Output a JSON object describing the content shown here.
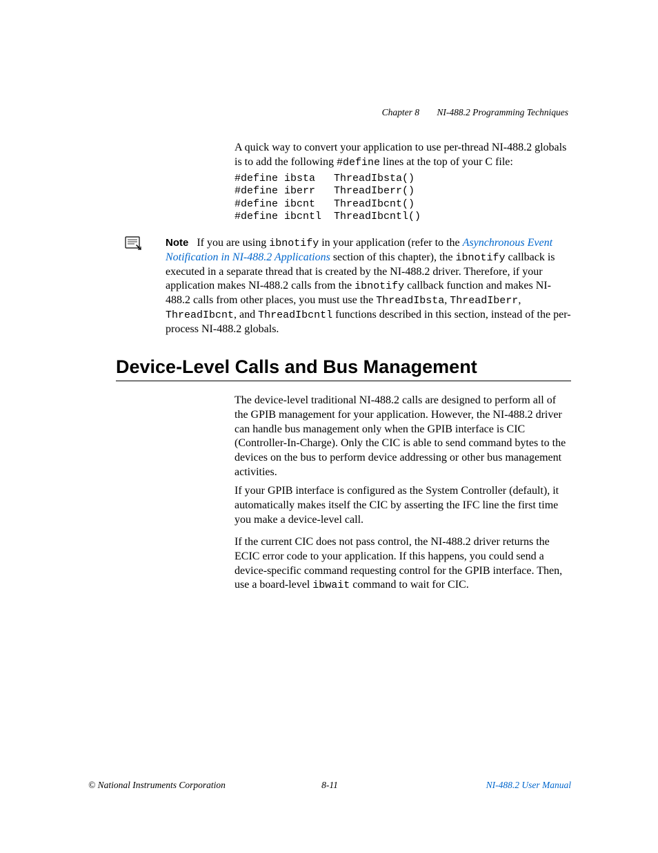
{
  "header": {
    "chapter": "Chapter 8",
    "title": "NI-488.2 Programming Techniques"
  },
  "intro": {
    "text_before": "A quick way to convert your application to use per-thread NI-488.2 globals is to add the following ",
    "code_word": "#define",
    "text_after": " lines at the top of your C file:"
  },
  "code": "#define ibsta   ThreadIbsta()\n#define iberr   ThreadIberr()\n#define ibcnt   ThreadIbcnt()\n#define ibcntl  ThreadIbcntl()",
  "note": {
    "label": "Note",
    "t1": "If you are using ",
    "c1": "ibnotify",
    "t2": " in your application (refer to the ",
    "link": "Asynchronous Event Notification in NI-488.2 Applications",
    "t3": " section of this chapter), the ",
    "c2": "ibnotify",
    "t4": " callback is executed in a separate thread that is created by the NI-488.2 driver. Therefore, if your application makes NI-488.2 calls from the ",
    "c3": "ibnotify",
    "t5": " callback function and makes NI-488.2 calls from other places, you must use the ",
    "c4": "ThreadIbsta",
    "t6": ", ",
    "c5": "ThreadIberr",
    "t7": ", ",
    "c6": "ThreadIbcnt",
    "t8": ", and ",
    "c7": "ThreadIbcntl",
    "t9": " functions described in this section, instead of the per-process NI-488.2 globals."
  },
  "section_heading": "Device-Level Calls and Bus Management",
  "para1": "The device-level traditional NI-488.2 calls are designed to perform all of the GPIB management for your application. However, the NI-488.2 driver can handle bus management only when the GPIB interface is CIC (Controller-In-Charge). Only the CIC is able to send command bytes to the devices on the bus to perform device addressing or other bus management activities.",
  "para2": "If your GPIB interface is configured as the System Controller (default), it automatically makes itself the CIC by asserting the IFC line the first time you make a device-level call.",
  "para3": {
    "t1": "If the current CIC does not pass control, the NI-488.2 driver returns the ECIC error code to your application. If this happens, you could send a device-specific command requesting control for the GPIB interface. Then, use a board-level ",
    "c1": "ibwait",
    "t2": " command to wait for CIC."
  },
  "footer": {
    "left": "© National Instruments Corporation",
    "center": "8-11",
    "right": "NI-488.2 User Manual"
  }
}
